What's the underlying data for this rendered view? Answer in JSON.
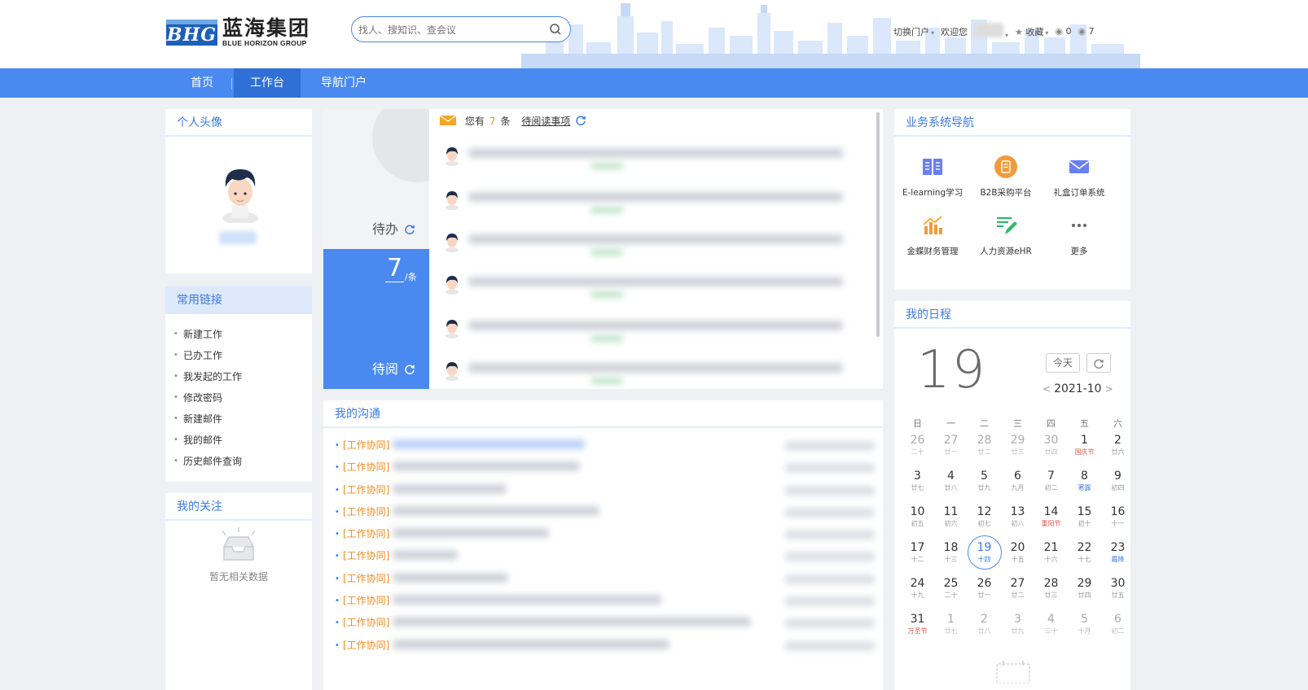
{
  "header": {
    "logo_mark": "BHG",
    "logo_cn": "蓝海集团",
    "logo_en": "BLUE HORIZON GROUP",
    "search_placeholder": "找人、搜知识、查会议",
    "switch_portal": "切换门户",
    "welcome": "欢迎您",
    "favorites": "收藏",
    "count_a": "0",
    "count_b": "7"
  },
  "nav": {
    "items": [
      "首页",
      "工作台",
      "导航门户"
    ],
    "active": "工作台"
  },
  "avatar_panel": {
    "title": "个人头像"
  },
  "links_panel": {
    "title": "常用链接",
    "items": [
      "新建工作",
      "已办工作",
      "我发起的工作",
      "修改密码",
      "新建邮件",
      "我的邮件",
      "历史邮件查询"
    ]
  },
  "follow_panel": {
    "title": "我的关注",
    "empty_text": "暂无相关数据"
  },
  "todo": {
    "daiban_label": "待办",
    "daiyue_label": "待阅",
    "count": "7",
    "unit": "/条",
    "head_prefix": "您有",
    "head_count": "7",
    "head_mid": "条",
    "head_link": "待阅读事项"
  },
  "comm_panel": {
    "title": "我的沟通",
    "tag": "[工作协同]"
  },
  "sys_panel": {
    "title": "业务系统导航",
    "items": [
      {
        "label": "E-learning学习",
        "icon": "book-icon"
      },
      {
        "label": "B2B采购平台",
        "icon": "purchase-icon"
      },
      {
        "label": "礼盒订单系统",
        "icon": "mail-icon"
      },
      {
        "label": "金蝶财务管理",
        "icon": "finance-chart-icon"
      },
      {
        "label": "人力资源eHR",
        "icon": "edit-list-icon"
      },
      {
        "label": "更多",
        "icon": "more-icon"
      }
    ],
    "colors": {
      "blue": "#4a89f0",
      "orange": "#f39a3a",
      "green": "#2eb86a"
    }
  },
  "calendar": {
    "title": "我的日程",
    "big_day": "19",
    "today_btn": "今天",
    "month": "2021-10",
    "weekdays": [
      "日",
      "一",
      "二",
      "三",
      "四",
      "五",
      "六"
    ],
    "weeks": [
      [
        [
          "26",
          "二十",
          "dim"
        ],
        [
          "27",
          "廿一",
          "dim"
        ],
        [
          "28",
          "廿二",
          "dim"
        ],
        [
          "29",
          "廿三",
          "dim"
        ],
        [
          "30",
          "廿四",
          "dim"
        ],
        [
          "1",
          "国庆节",
          "red"
        ],
        [
          "2",
          "廿六",
          ""
        ]
      ],
      [
        [
          "3",
          "廿七",
          ""
        ],
        [
          "4",
          "廿八",
          ""
        ],
        [
          "5",
          "廿九",
          ""
        ],
        [
          "6",
          "九月",
          ""
        ],
        [
          "7",
          "初二",
          ""
        ],
        [
          "8",
          "寒露",
          "blue"
        ],
        [
          "9",
          "初四",
          ""
        ]
      ],
      [
        [
          "10",
          "初五",
          ""
        ],
        [
          "11",
          "初六",
          ""
        ],
        [
          "12",
          "初七",
          ""
        ],
        [
          "13",
          "初八",
          ""
        ],
        [
          "14",
          "重阳节",
          "red"
        ],
        [
          "15",
          "初十",
          ""
        ],
        [
          "16",
          "十一",
          ""
        ]
      ],
      [
        [
          "17",
          "十二",
          ""
        ],
        [
          "18",
          "十三",
          ""
        ],
        [
          "19",
          "十四",
          "today"
        ],
        [
          "20",
          "十五",
          ""
        ],
        [
          "21",
          "十六",
          ""
        ],
        [
          "22",
          "十七",
          ""
        ],
        [
          "23",
          "霜降",
          "blue"
        ]
      ],
      [
        [
          "24",
          "十九",
          ""
        ],
        [
          "25",
          "二十",
          ""
        ],
        [
          "26",
          "廿一",
          ""
        ],
        [
          "27",
          "廿二",
          ""
        ],
        [
          "28",
          "廿三",
          ""
        ],
        [
          "29",
          "廿四",
          ""
        ],
        [
          "30",
          "廿五",
          ""
        ]
      ],
      [
        [
          "31",
          "万圣节",
          "red"
        ],
        [
          "1",
          "廿七",
          "dim"
        ],
        [
          "2",
          "廿八",
          "dim"
        ],
        [
          "3",
          "廿九",
          "dim"
        ],
        [
          "4",
          "三十",
          "dim"
        ],
        [
          "5",
          "十月",
          "dim"
        ],
        [
          "6",
          "初二",
          "dim"
        ]
      ]
    ]
  }
}
